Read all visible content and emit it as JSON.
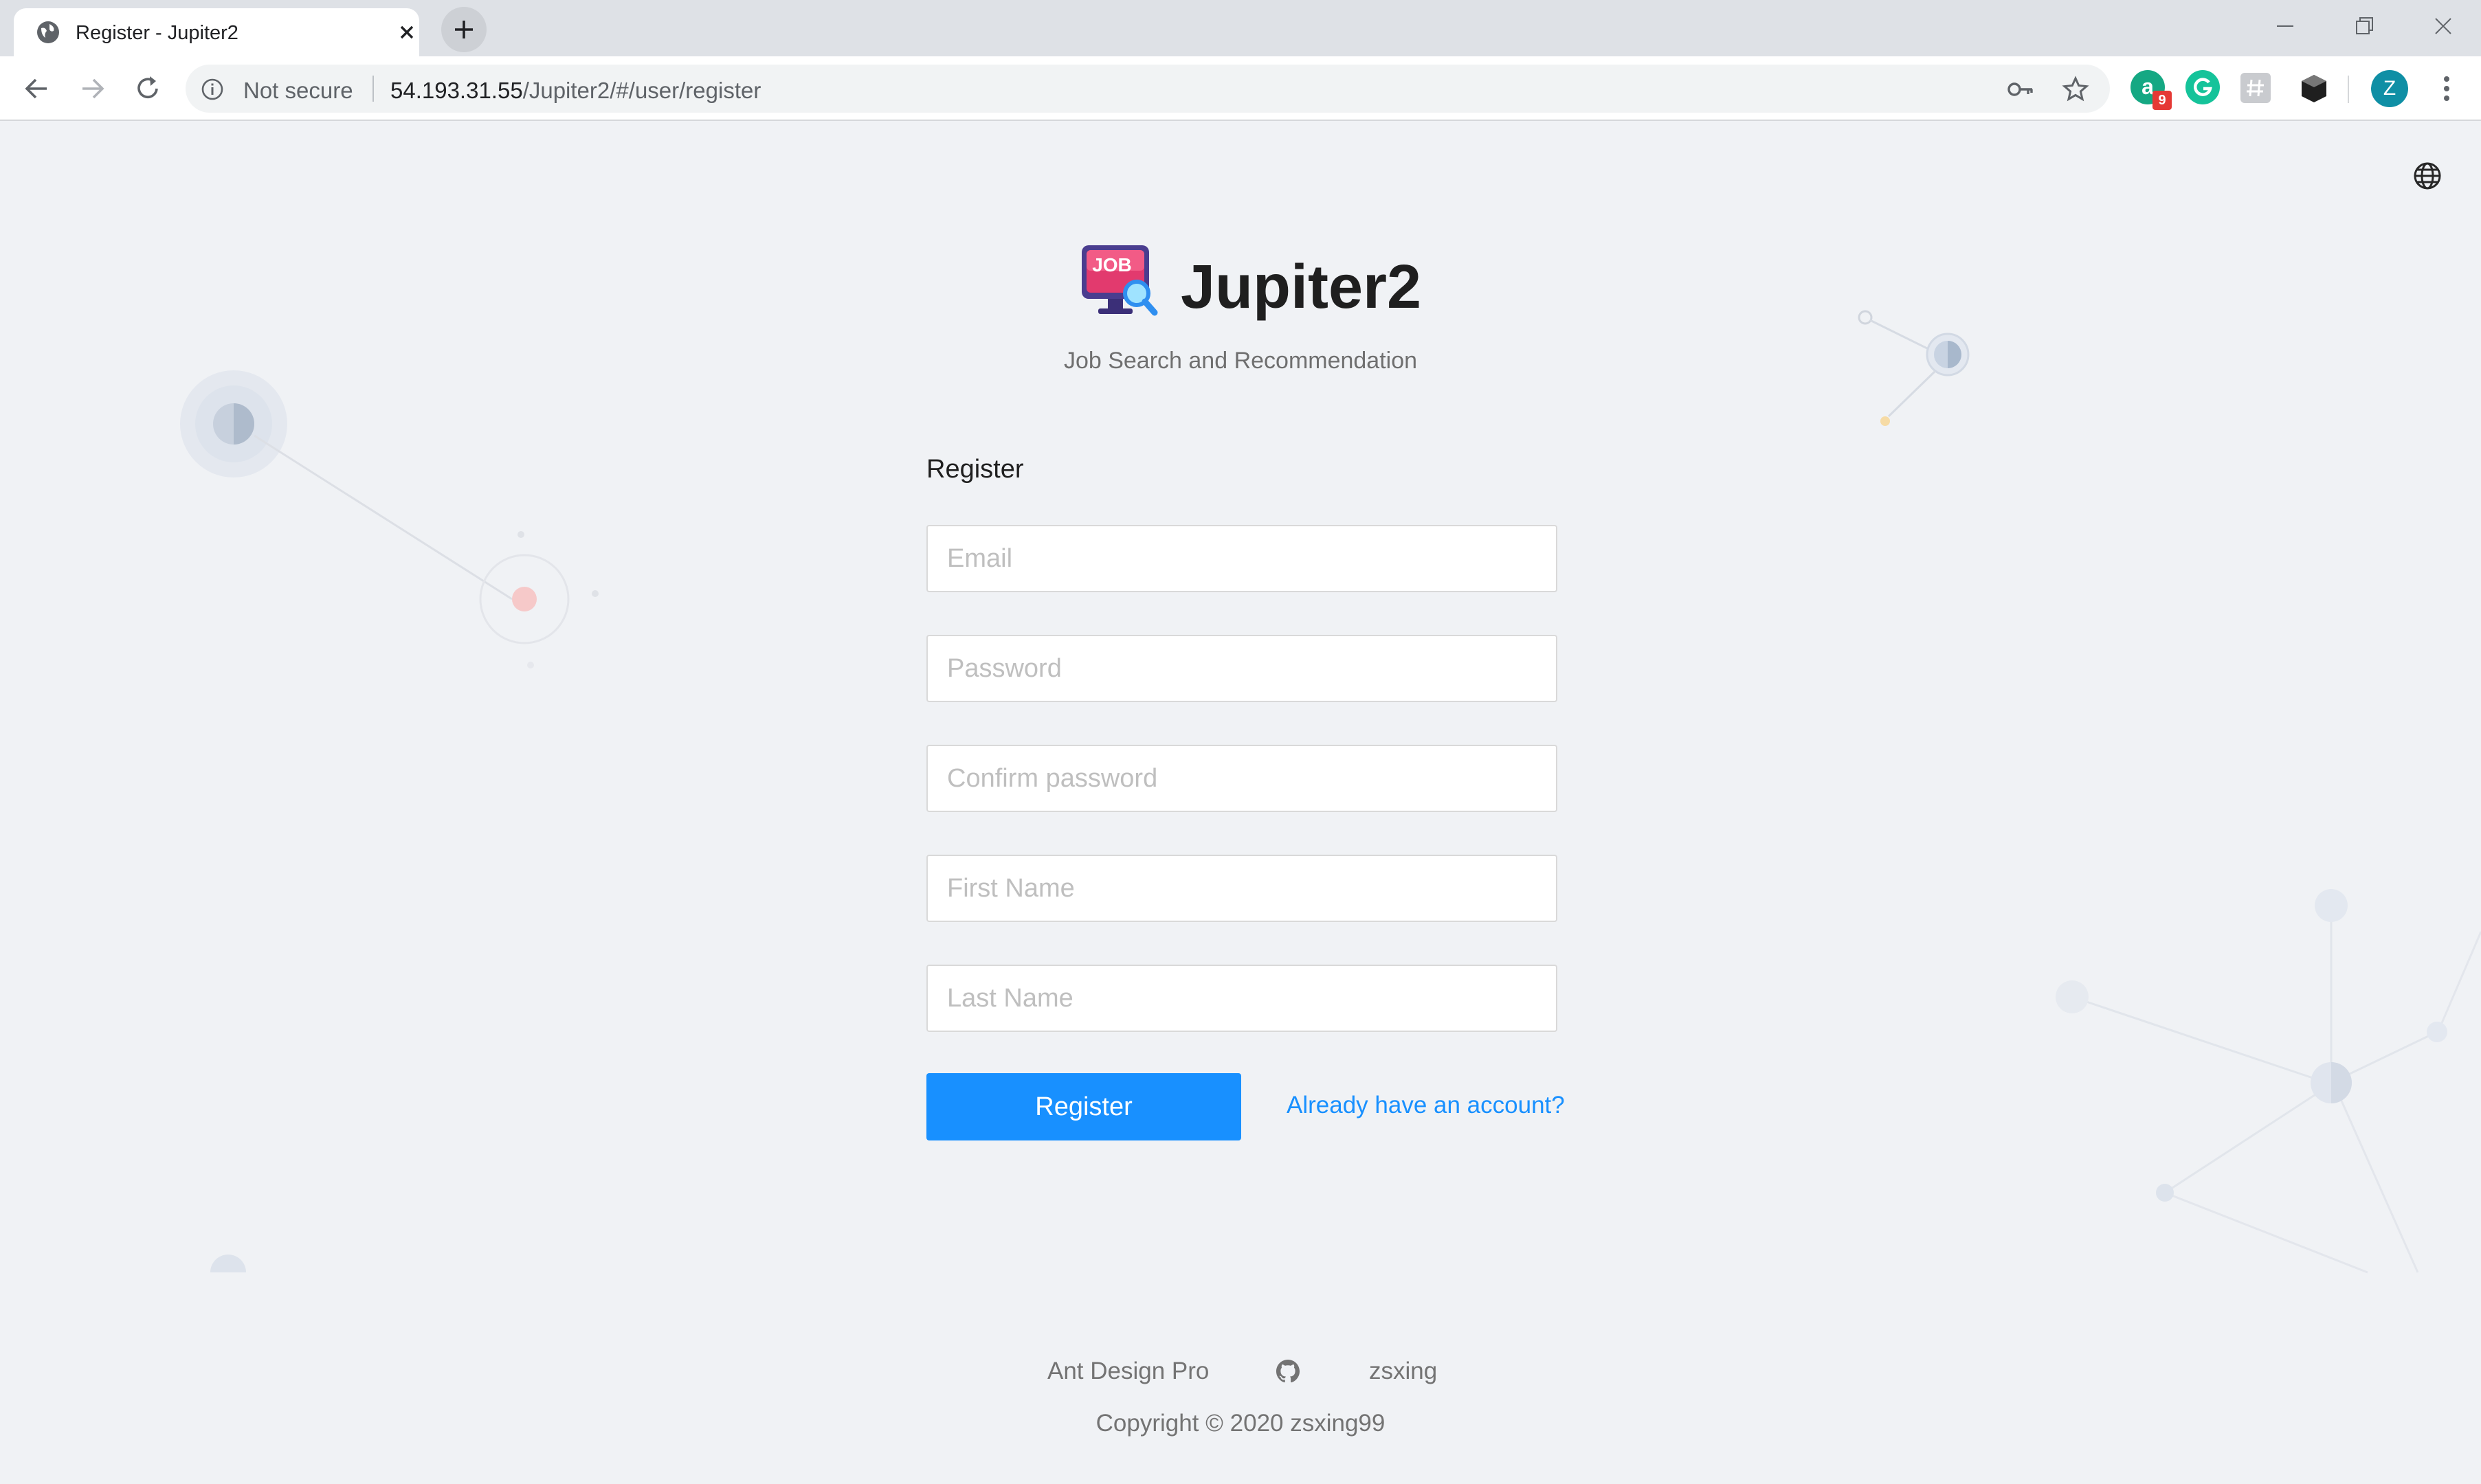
{
  "browser": {
    "tab_title": "Register - Jupiter2",
    "not_secure_label": "Not secure",
    "url_host": "54.193.31.55",
    "url_path": "/Jupiter2/#/user/register",
    "extension_badge": "9",
    "profile_initial": "Z"
  },
  "app": {
    "name": "Jupiter2",
    "logo_text": "JOB",
    "description": "Job Search and Recommendation"
  },
  "form": {
    "title": "Register",
    "email_placeholder": "Email",
    "password_placeholder": "Password",
    "confirm_placeholder": "Confirm password",
    "first_name_placeholder": "First Name",
    "last_name_placeholder": "Last Name",
    "submit_label": "Register",
    "login_link": "Already have an account?"
  },
  "footer": {
    "link_ant": "Ant Design Pro",
    "link_user": "zsxing",
    "copyright": "Copyright © 2020 zsxing99"
  },
  "colors": {
    "primary": "#1890ff",
    "page_bg": "#f0f2f5"
  }
}
